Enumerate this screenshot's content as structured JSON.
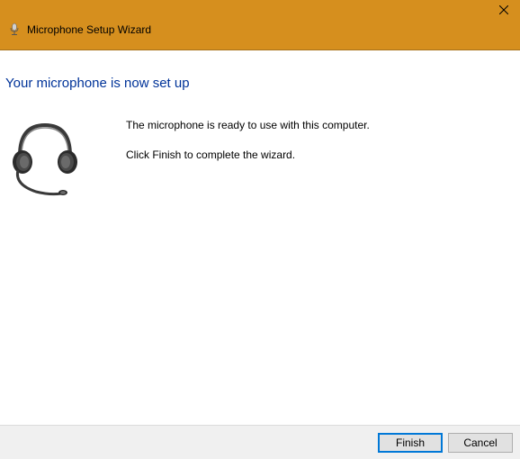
{
  "titlebar": {
    "title": "Microphone Setup Wizard"
  },
  "content": {
    "heading": "Your microphone is now set up",
    "line1": "The microphone is ready to use with this computer.",
    "line2": "Click Finish to complete the wizard."
  },
  "footer": {
    "finish_label": "Finish",
    "cancel_label": "Cancel"
  }
}
